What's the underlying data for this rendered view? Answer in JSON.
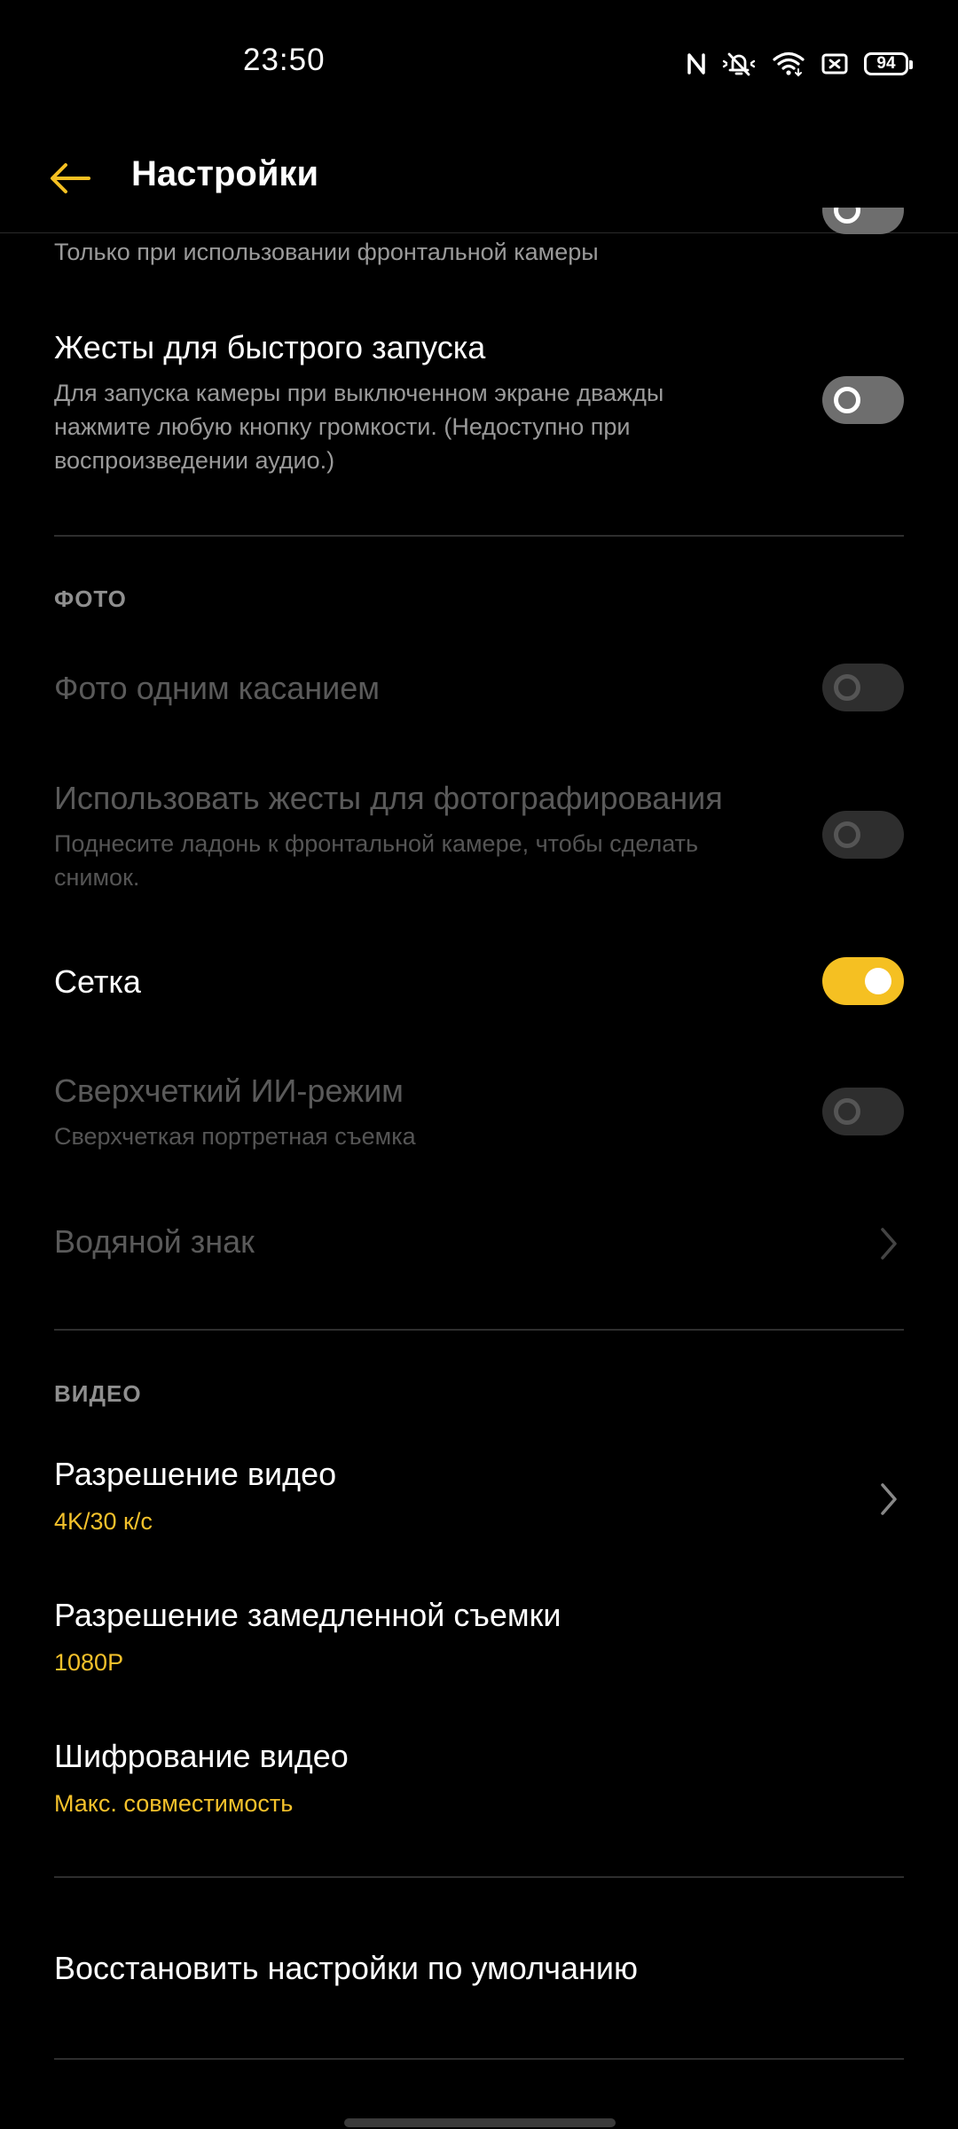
{
  "status_bar": {
    "time": "23:50",
    "battery": "94",
    "icons": [
      "nfc-icon",
      "silent-bell-icon",
      "wifi-icon",
      "screen-record-icon",
      "battery-icon"
    ]
  },
  "app_bar": {
    "title": "Настройки",
    "back_icon": "arrow-left-icon"
  },
  "colors": {
    "accent": "#f5c022",
    "value_text": "#f4c12b",
    "background": "#000000"
  },
  "settings": {
    "front_camera_note": "Только при использовании фронтальной камеры",
    "quick_launch": {
      "title": "Жесты для быстрого запуска",
      "subtitle": "Для запуска камеры при выключенном экране дважды нажмите любую кнопку громкости. (Недоступно при воспроизведении аудио.)",
      "enabled": false
    },
    "photo_section": "ФОТО",
    "one_touch_photo": {
      "title": "Фото одним касанием",
      "enabled": false,
      "disabled": true
    },
    "gesture_photo": {
      "title": "Использовать жесты для фотографирования",
      "subtitle": "Поднесите ладонь к фронтальной камере, чтобы сделать снимок.",
      "enabled": false,
      "disabled": true
    },
    "grid": {
      "title": "Сетка",
      "enabled": true
    },
    "ai_mode": {
      "title": "Сверхчеткий ИИ-режим",
      "subtitle": "Сверхчеткая портретная съемка",
      "enabled": false,
      "disabled": true
    },
    "watermark": {
      "title": "Водяной знак",
      "disabled": true
    },
    "video_section": "ВИДЕО",
    "video_resolution": {
      "title": "Разрешение видео",
      "value": "4K/30 к/с"
    },
    "slowmo_resolution": {
      "title": "Разрешение замедленной съемки",
      "value": "1080P"
    },
    "video_encoding": {
      "title": "Шифрование видео",
      "value": "Макс. совместимость"
    },
    "reset": {
      "title": "Восстановить настройки по умолчанию"
    }
  }
}
